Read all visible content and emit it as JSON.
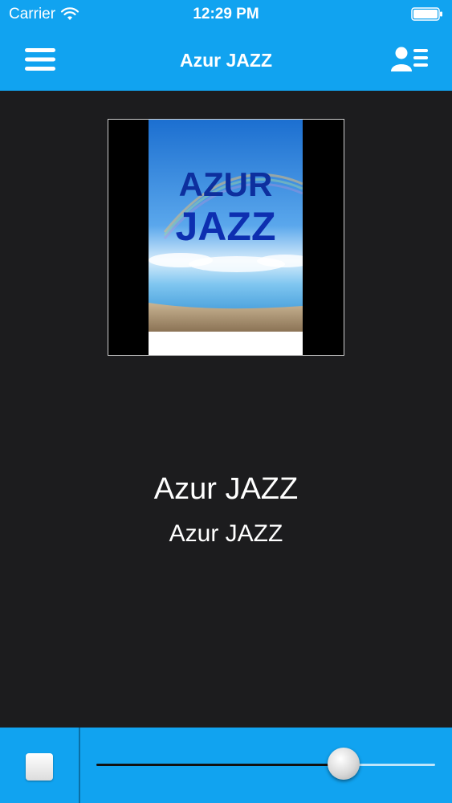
{
  "status_bar": {
    "carrier": "Carrier",
    "time": "12:29 PM"
  },
  "nav": {
    "title": "Azur JAZZ",
    "left_icon": "hamburger-menu-icon",
    "right_icon": "contacts-list-icon"
  },
  "album_art": {
    "text_line1": "AZUR",
    "text_line2": "JAZZ"
  },
  "now_playing": {
    "title": "Azur JAZZ",
    "artist": "Azur JAZZ"
  },
  "player": {
    "stop_icon": "stop-icon",
    "volume_level": 0.73
  },
  "colors": {
    "accent": "#11a3f0",
    "background": "#1c1c1e"
  }
}
